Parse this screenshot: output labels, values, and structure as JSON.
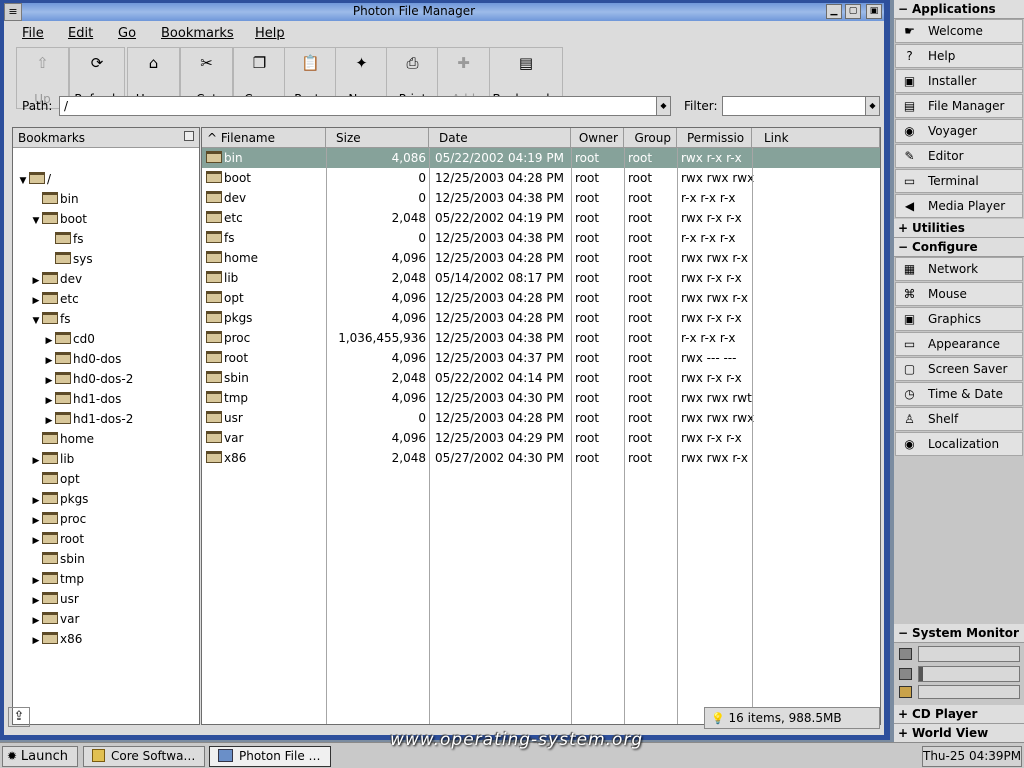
{
  "window": {
    "title": "Photon File Manager",
    "menu_glyph": "≡",
    "btn_min": "▁",
    "btn_max": "▢",
    "btn_close": "▣"
  },
  "menus": [
    "File",
    "Edit",
    "Go",
    "Bookmarks",
    "Help"
  ],
  "toolbar": [
    {
      "label": "Up",
      "icon": "up-arrow-icon",
      "glyph": "⇧",
      "disabled": true
    },
    {
      "label": "Refresh",
      "icon": "refresh-icon",
      "glyph": "⟳",
      "disabled": false
    },
    {
      "label": "Home",
      "icon": "home-icon",
      "glyph": "⌂",
      "disabled": false
    },
    {
      "label": "Cut",
      "icon": "scissors-icon",
      "glyph": "✂",
      "disabled": false
    },
    {
      "label": "Copy",
      "icon": "copy-icon",
      "glyph": "❐",
      "disabled": false
    },
    {
      "label": "Paste",
      "icon": "paste-icon",
      "glyph": "📋",
      "disabled": false
    },
    {
      "label": "New",
      "icon": "new-folder-icon",
      "glyph": "✦",
      "disabled": false
    },
    {
      "label": "Print",
      "icon": "printer-icon",
      "glyph": "⎙",
      "disabled": false
    },
    {
      "label": "Add",
      "icon": "add-bookmark-icon",
      "glyph": "✚",
      "disabled": true
    },
    {
      "label": "Bookmarks",
      "icon": "bookmarks-icon",
      "glyph": "▤",
      "disabled": false
    }
  ],
  "path": {
    "label": "Path:",
    "value": "/"
  },
  "filter": {
    "label": "Filter:",
    "value": ""
  },
  "dropdown_glyph": "◆",
  "bookmarks": {
    "title": "Bookmarks",
    "tree": [
      {
        "label": "/",
        "depth": 0,
        "toggle": "▼"
      },
      {
        "label": "bin",
        "depth": 1,
        "toggle": ""
      },
      {
        "label": "boot",
        "depth": 1,
        "toggle": "▼"
      },
      {
        "label": "fs",
        "depth": 2,
        "toggle": ""
      },
      {
        "label": "sys",
        "depth": 2,
        "toggle": ""
      },
      {
        "label": "dev",
        "depth": 1,
        "toggle": "▶"
      },
      {
        "label": "etc",
        "depth": 1,
        "toggle": "▶"
      },
      {
        "label": "fs",
        "depth": 1,
        "toggle": "▼"
      },
      {
        "label": "cd0",
        "depth": 2,
        "toggle": "▶"
      },
      {
        "label": "hd0-dos",
        "depth": 2,
        "toggle": "▶"
      },
      {
        "label": "hd0-dos-2",
        "depth": 2,
        "toggle": "▶"
      },
      {
        "label": "hd1-dos",
        "depth": 2,
        "toggle": "▶"
      },
      {
        "label": "hd1-dos-2",
        "depth": 2,
        "toggle": "▶"
      },
      {
        "label": "home",
        "depth": 1,
        "toggle": ""
      },
      {
        "label": "lib",
        "depth": 1,
        "toggle": "▶"
      },
      {
        "label": "opt",
        "depth": 1,
        "toggle": ""
      },
      {
        "label": "pkgs",
        "depth": 1,
        "toggle": "▶"
      },
      {
        "label": "proc",
        "depth": 1,
        "toggle": "▶"
      },
      {
        "label": "root",
        "depth": 1,
        "toggle": "▶"
      },
      {
        "label": "sbin",
        "depth": 1,
        "toggle": ""
      },
      {
        "label": "tmp",
        "depth": 1,
        "toggle": "▶"
      },
      {
        "label": "usr",
        "depth": 1,
        "toggle": "▶"
      },
      {
        "label": "var",
        "depth": 1,
        "toggle": "▶"
      },
      {
        "label": "x86",
        "depth": 1,
        "toggle": "▶"
      }
    ]
  },
  "filelist": {
    "sort_glyph": "^",
    "columns": [
      "Filename",
      "Size",
      "Date",
      "Owner",
      "Group",
      "Permissio",
      "Link"
    ],
    "rows": [
      {
        "name": "bin",
        "size": "4,086",
        "date": "05/22/2002 04:19 PM",
        "owner": "root",
        "group": "root",
        "perm": "rwx r-x r-x",
        "link": "",
        "selected": true
      },
      {
        "name": "boot",
        "size": "0",
        "date": "12/25/2003 04:28 PM",
        "owner": "root",
        "group": "root",
        "perm": "rwx rwx rwx",
        "link": ""
      },
      {
        "name": "dev",
        "size": "0",
        "date": "12/25/2003 04:38 PM",
        "owner": "root",
        "group": "root",
        "perm": "r-x r-x r-x",
        "link": ""
      },
      {
        "name": "etc",
        "size": "2,048",
        "date": "05/22/2002 04:19 PM",
        "owner": "root",
        "group": "root",
        "perm": "rwx r-x r-x",
        "link": ""
      },
      {
        "name": "fs",
        "size": "0",
        "date": "12/25/2003 04:38 PM",
        "owner": "root",
        "group": "root",
        "perm": "r-x r-x r-x",
        "link": ""
      },
      {
        "name": "home",
        "size": "4,096",
        "date": "12/25/2003 04:28 PM",
        "owner": "root",
        "group": "root",
        "perm": "rwx rwx r-x",
        "link": ""
      },
      {
        "name": "lib",
        "size": "2,048",
        "date": "05/14/2002 08:17 PM",
        "owner": "root",
        "group": "root",
        "perm": "rwx r-x r-x",
        "link": ""
      },
      {
        "name": "opt",
        "size": "4,096",
        "date": "12/25/2003 04:28 PM",
        "owner": "root",
        "group": "root",
        "perm": "rwx rwx r-x",
        "link": ""
      },
      {
        "name": "pkgs",
        "size": "4,096",
        "date": "12/25/2003 04:28 PM",
        "owner": "root",
        "group": "root",
        "perm": "rwx r-x r-x",
        "link": ""
      },
      {
        "name": "proc",
        "size": "1,036,455,936",
        "date": "12/25/2003 04:38 PM",
        "owner": "root",
        "group": "root",
        "perm": "r-x r-x r-x",
        "link": ""
      },
      {
        "name": "root",
        "size": "4,096",
        "date": "12/25/2003 04:37 PM",
        "owner": "root",
        "group": "root",
        "perm": "rwx --- ---",
        "link": ""
      },
      {
        "name": "sbin",
        "size": "2,048",
        "date": "05/22/2002 04:14 PM",
        "owner": "root",
        "group": "root",
        "perm": "rwx r-x r-x",
        "link": ""
      },
      {
        "name": "tmp",
        "size": "4,096",
        "date": "12/25/2003 04:30 PM",
        "owner": "root",
        "group": "root",
        "perm": "rwx rwx rwt",
        "link": ""
      },
      {
        "name": "usr",
        "size": "0",
        "date": "12/25/2003 04:28 PM",
        "owner": "root",
        "group": "root",
        "perm": "rwx rwx rwx",
        "link": ""
      },
      {
        "name": "var",
        "size": "4,096",
        "date": "12/25/2003 04:29 PM",
        "owner": "root",
        "group": "root",
        "perm": "rwx r-x r-x",
        "link": ""
      },
      {
        "name": "x86",
        "size": "2,048",
        "date": "05/27/2002 04:30 PM",
        "owner": "root",
        "group": "root",
        "perm": "rwx rwx r-x",
        "link": ""
      }
    ]
  },
  "status": {
    "summary": "16 items, 988.5MB",
    "left_icon_glyph": "⇪",
    "bulb_glyph": "💡"
  },
  "shelf": {
    "sections": [
      {
        "title": "Applications",
        "items": [
          {
            "label": "Welcome",
            "icon": "welcome-icon",
            "glyph": "☛"
          },
          {
            "label": "Help",
            "icon": "help-icon",
            "glyph": "?"
          },
          {
            "label": "Installer",
            "icon": "installer-icon",
            "glyph": "▣"
          },
          {
            "label": "File Manager",
            "icon": "file-manager-icon",
            "glyph": "▤"
          },
          {
            "label": "Voyager",
            "icon": "globe-icon",
            "glyph": "◉"
          },
          {
            "label": "Editor",
            "icon": "editor-icon",
            "glyph": "✎"
          },
          {
            "label": "Terminal",
            "icon": "terminal-icon",
            "glyph": "▭"
          },
          {
            "label": "Media Player",
            "icon": "speaker-icon",
            "glyph": "◀"
          }
        ]
      },
      {
        "title": "Utilities",
        "items": []
      },
      {
        "title": "Configure",
        "items": [
          {
            "label": "Network",
            "icon": "network-icon",
            "glyph": "▦"
          },
          {
            "label": "Mouse",
            "icon": "mouse-icon",
            "glyph": "⌘"
          },
          {
            "label": "Graphics",
            "icon": "graphics-icon",
            "glyph": "▣"
          },
          {
            "label": "Appearance",
            "icon": "appearance-icon",
            "glyph": "▭"
          },
          {
            "label": "Screen Saver",
            "icon": "screen-saver-icon",
            "glyph": "▢"
          },
          {
            "label": "Time & Date",
            "icon": "clock-globe-icon",
            "glyph": "◷"
          },
          {
            "label": "Shelf",
            "icon": "shelf-icon",
            "glyph": "♙"
          },
          {
            "label": "Localization",
            "icon": "localization-icon",
            "glyph": "◉"
          }
        ]
      }
    ],
    "system_monitor": {
      "title": "System Monitor",
      "cpu_fraction": 0.0,
      "mem_fraction": 0.04
    },
    "bottom_sections": [
      {
        "title": "CD Player"
      },
      {
        "title": "World View"
      }
    ]
  },
  "taskbar": {
    "launch": "Launch",
    "tasks": [
      {
        "label": "Core Softwa…",
        "icon": "package-icon"
      },
      {
        "label": "Photon File …",
        "icon": "file-manager-icon",
        "active": true
      }
    ],
    "clock": "Thu-25 04:39PM"
  },
  "watermark": "www.operating-system.org",
  "colors": {
    "title_bar": "#8eb0e6",
    "selection": "#86a29a",
    "window_border": "#2d4f9c"
  }
}
